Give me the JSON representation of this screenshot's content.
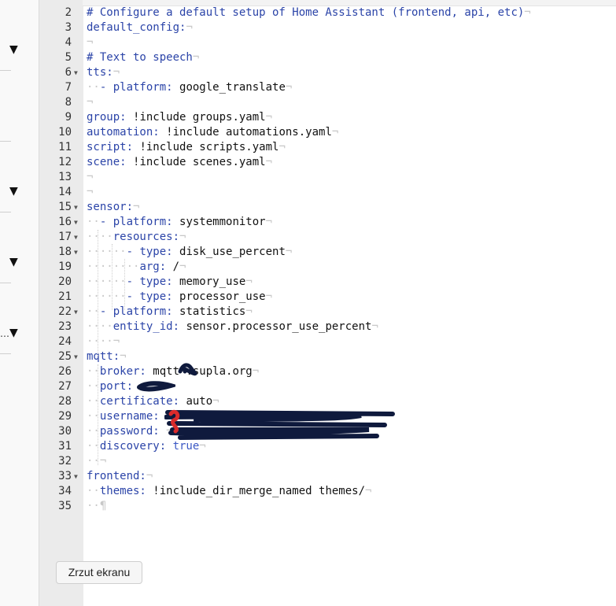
{
  "tooltip": {
    "label": "Zrzut ekranu"
  },
  "sidebar": {
    "ellipsis": "…"
  },
  "editor": {
    "markers": {
      "space": "·",
      "eol": "¬",
      "eof": "¶"
    },
    "lines": [
      {
        "n": "2",
        "fold": false,
        "indent": "",
        "parts": [
          {
            "t": "# Configure a default setup of Home Assistant (frontend, api, etc)",
            "c": "c"
          }
        ]
      },
      {
        "n": "3",
        "fold": false,
        "indent": "",
        "parts": [
          {
            "t": "default_config:",
            "c": "k"
          }
        ]
      },
      {
        "n": "4",
        "fold": false,
        "indent": "",
        "parts": []
      },
      {
        "n": "5",
        "fold": false,
        "indent": "",
        "parts": [
          {
            "t": "# Text to speech",
            "c": "c"
          }
        ]
      },
      {
        "n": "6",
        "fold": true,
        "indent": "",
        "parts": [
          {
            "t": "tts:",
            "c": "k"
          }
        ]
      },
      {
        "n": "7",
        "fold": false,
        "indent": "··",
        "parts": [
          {
            "t": "- ",
            "c": "k"
          },
          {
            "t": "platform: ",
            "c": "k"
          },
          {
            "t": "google_translate",
            "c": "v"
          }
        ]
      },
      {
        "n": "8",
        "fold": false,
        "indent": "",
        "parts": []
      },
      {
        "n": "9",
        "fold": false,
        "indent": "",
        "parts": [
          {
            "t": "group: ",
            "c": "k"
          },
          {
            "t": "!include groups.yaml",
            "c": "v"
          }
        ]
      },
      {
        "n": "10",
        "fold": false,
        "indent": "",
        "parts": [
          {
            "t": "automation: ",
            "c": "k"
          },
          {
            "t": "!include automations.yaml",
            "c": "v"
          }
        ]
      },
      {
        "n": "11",
        "fold": false,
        "indent": "",
        "parts": [
          {
            "t": "script: ",
            "c": "k"
          },
          {
            "t": "!include scripts.yaml",
            "c": "v"
          }
        ]
      },
      {
        "n": "12",
        "fold": false,
        "indent": "",
        "parts": [
          {
            "t": "scene: ",
            "c": "k"
          },
          {
            "t": "!include scenes.yaml",
            "c": "v"
          }
        ]
      },
      {
        "n": "13",
        "fold": false,
        "indent": "",
        "parts": []
      },
      {
        "n": "14",
        "fold": false,
        "indent": "",
        "parts": []
      },
      {
        "n": "15",
        "fold": true,
        "indent": "",
        "parts": [
          {
            "t": "sensor:",
            "c": "k"
          }
        ]
      },
      {
        "n": "16",
        "fold": true,
        "indent": "··",
        "parts": [
          {
            "t": "- ",
            "c": "k"
          },
          {
            "t": "platform: ",
            "c": "k"
          },
          {
            "t": "systemmonitor",
            "c": "v"
          }
        ]
      },
      {
        "n": "17",
        "fold": true,
        "indent": "····",
        "parts": [
          {
            "t": "resources:",
            "c": "k"
          }
        ]
      },
      {
        "n": "18",
        "fold": true,
        "indent": "······",
        "parts": [
          {
            "t": "- ",
            "c": "k"
          },
          {
            "t": "type: ",
            "c": "k"
          },
          {
            "t": "disk_use_percent",
            "c": "v"
          }
        ]
      },
      {
        "n": "19",
        "fold": false,
        "indent": "········",
        "parts": [
          {
            "t": "arg: ",
            "c": "k"
          },
          {
            "t": "/",
            "c": "v"
          }
        ]
      },
      {
        "n": "20",
        "fold": false,
        "indent": "······",
        "parts": [
          {
            "t": "- ",
            "c": "k"
          },
          {
            "t": "type: ",
            "c": "k"
          },
          {
            "t": "memory_use",
            "c": "v"
          }
        ]
      },
      {
        "n": "21",
        "fold": false,
        "indent": "······",
        "parts": [
          {
            "t": "- ",
            "c": "k"
          },
          {
            "t": "type: ",
            "c": "k"
          },
          {
            "t": "processor_use",
            "c": "v"
          }
        ]
      },
      {
        "n": "22",
        "fold": true,
        "indent": "··",
        "parts": [
          {
            "t": "- ",
            "c": "k"
          },
          {
            "t": "platform: ",
            "c": "k"
          },
          {
            "t": "statistics",
            "c": "v"
          }
        ]
      },
      {
        "n": "23",
        "fold": false,
        "indent": "····",
        "parts": [
          {
            "t": "entity_id: ",
            "c": "k"
          },
          {
            "t": "sensor.processor_use_percent",
            "c": "v"
          }
        ]
      },
      {
        "n": "24",
        "fold": false,
        "indent": "····",
        "parts": []
      },
      {
        "n": "25",
        "fold": true,
        "indent": "",
        "parts": [
          {
            "t": "mqtt:",
            "c": "k"
          }
        ]
      },
      {
        "n": "26",
        "fold": false,
        "indent": "··",
        "parts": [
          {
            "t": "broker: ",
            "c": "k"
          },
          {
            "t": "mqtt .supla.org",
            "c": "v"
          }
        ]
      },
      {
        "n": "27",
        "fold": false,
        "indent": "··",
        "parts": [
          {
            "t": "port: ",
            "c": "k"
          }
        ]
      },
      {
        "n": "28",
        "fold": false,
        "indent": "··",
        "parts": [
          {
            "t": "certificate: ",
            "c": "k"
          },
          {
            "t": "auto",
            "c": "v"
          }
        ]
      },
      {
        "n": "29",
        "fold": false,
        "indent": "··",
        "parts": [
          {
            "t": "username: ",
            "c": "k"
          }
        ]
      },
      {
        "n": "30",
        "fold": false,
        "indent": "··",
        "parts": [
          {
            "t": "password: ",
            "c": "k"
          }
        ]
      },
      {
        "n": "31",
        "fold": false,
        "indent": "··",
        "parts": [
          {
            "t": "discovery: ",
            "c": "k"
          },
          {
            "t": "true",
            "c": "b"
          }
        ]
      },
      {
        "n": "32",
        "fold": false,
        "indent": "··",
        "parts": []
      },
      {
        "n": "33",
        "fold": true,
        "indent": "",
        "parts": [
          {
            "t": "frontend:",
            "c": "k"
          }
        ]
      },
      {
        "n": "34",
        "fold": false,
        "indent": "··",
        "parts": [
          {
            "t": "themes: ",
            "c": "k"
          },
          {
            "t": "!include_dir_merge_named themes/",
            "c": "v"
          }
        ]
      },
      {
        "n": "35",
        "fold": false,
        "indent": "··",
        "parts": [],
        "eof": true
      }
    ]
  }
}
